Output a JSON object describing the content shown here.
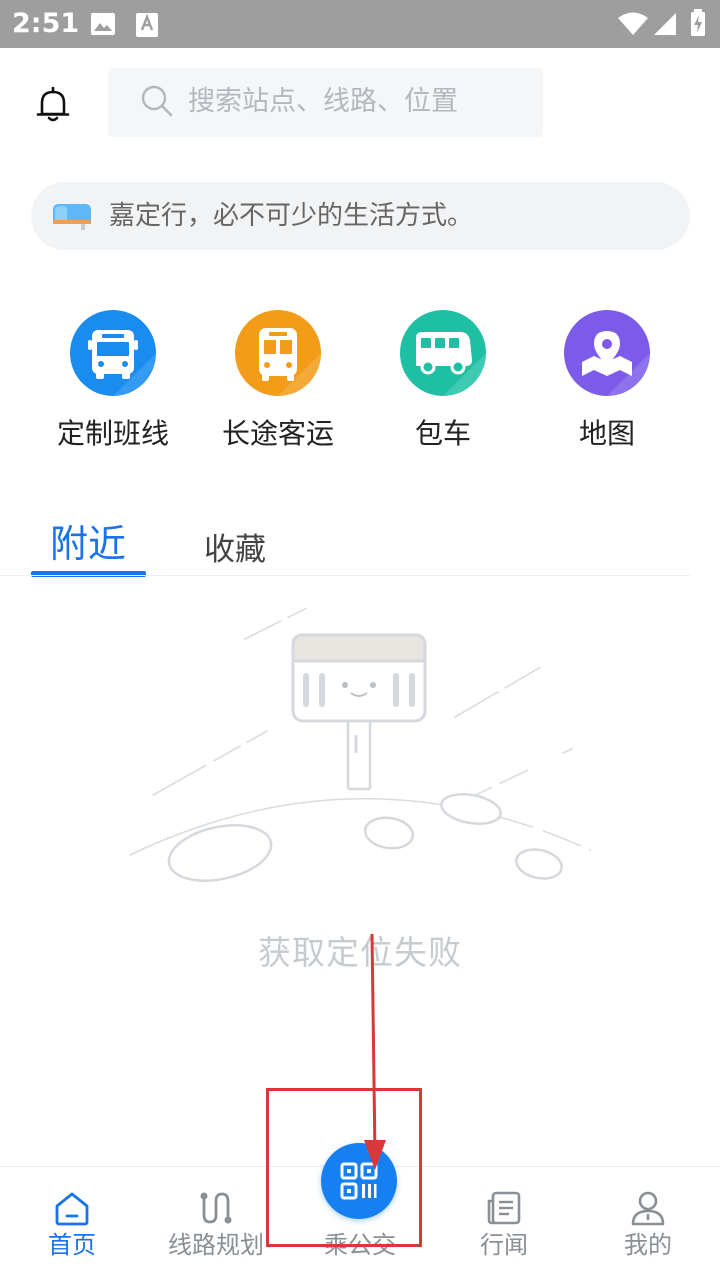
{
  "status_bar": {
    "time": "2:51",
    "icons": [
      "image-icon",
      "font-a-icon",
      "wifi-icon",
      "signal-icon",
      "battery-charging-icon"
    ]
  },
  "header": {
    "bell_icon": "bell-icon",
    "search_placeholder": "搜索站点、线路、位置"
  },
  "notice": {
    "icon": "mailbox-icon",
    "text": "嘉定行，必不可少的生活方式。"
  },
  "quick_menu": [
    {
      "label": "定制班线",
      "icon": "bus-front-icon",
      "color": "#1a8cf0"
    },
    {
      "label": "长途客运",
      "icon": "coach-icon",
      "color": "#f39c1a"
    },
    {
      "label": "包车",
      "icon": "van-icon",
      "color": "#1fbfa5"
    },
    {
      "label": "地图",
      "icon": "map-pin-icon",
      "color": "#7b5be8"
    }
  ],
  "tabs": [
    {
      "label": "附近",
      "active": true
    },
    {
      "label": "收藏",
      "active": false
    }
  ],
  "empty_state": {
    "illustration": "bus-stop-sign-illustration",
    "message": "获取定位失败"
  },
  "bottom_nav": [
    {
      "label": "首页",
      "icon": "home-icon",
      "active": true
    },
    {
      "label": "线路规划",
      "icon": "route-icon",
      "active": false
    },
    {
      "label": "乘公交",
      "icon": "qr-code-icon",
      "active": false
    },
    {
      "label": "行闻",
      "icon": "news-icon",
      "active": false
    },
    {
      "label": "我的",
      "icon": "user-icon",
      "active": false
    }
  ],
  "colors": {
    "accent": "#1a73e8",
    "fab": "#1680f2",
    "annotation": "#d9373a"
  }
}
